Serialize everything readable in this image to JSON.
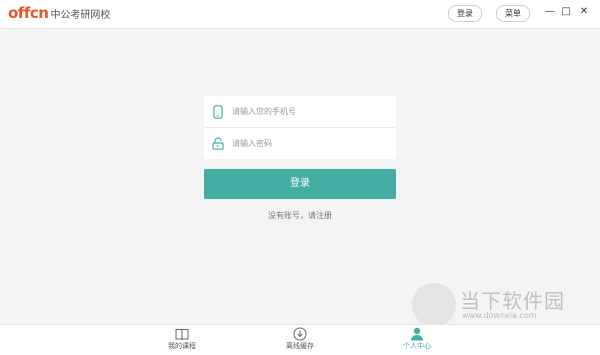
{
  "titlebar": {
    "logo_mark": "offcn",
    "logo_text": "中公考研网校",
    "login_label": "登录",
    "menu_label": "菜单",
    "minimize": "—",
    "maximize": "□",
    "close": "✕"
  },
  "form": {
    "phone_placeholder": "请输入您的手机号",
    "password_placeholder": "请输入密码",
    "login_button": "登录",
    "register_link": "没有账号，请注册"
  },
  "watermark": {
    "title": "当下软件园",
    "url": "www.downxia.com"
  },
  "bottom_nav": {
    "items": [
      {
        "label": "我的课程",
        "icon": "book-icon"
      },
      {
        "label": "离线缓存",
        "icon": "download-icon"
      },
      {
        "label": "个人中心",
        "icon": "user-icon",
        "active": true
      }
    ]
  },
  "colors": {
    "accent": "#45aea3",
    "brand": "#e8562b",
    "background": "#f4f4f4"
  }
}
